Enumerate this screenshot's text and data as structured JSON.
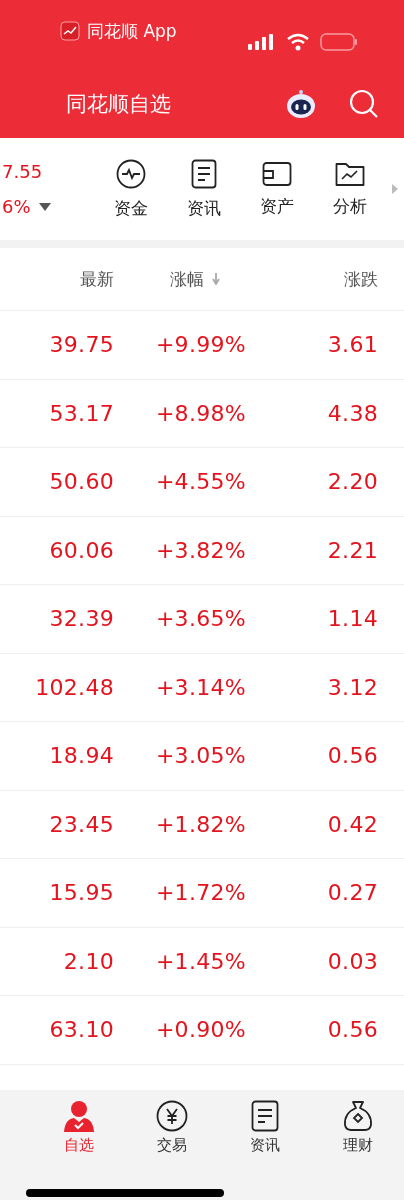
{
  "status_bar": {
    "app_name": "同花顺 App"
  },
  "header": {
    "title": "同花顺自选"
  },
  "summary": {
    "value": "7.55",
    "change": "6%"
  },
  "tools": [
    {
      "kind": "pulse",
      "label": "资金"
    },
    {
      "kind": "doc",
      "label": "资讯"
    },
    {
      "kind": "card",
      "label": "资产"
    },
    {
      "kind": "folder",
      "label": "分析"
    }
  ],
  "table": {
    "columns": [
      {
        "label": "最新",
        "sorted": false
      },
      {
        "label": "涨幅",
        "sorted": true
      },
      {
        "label": "涨跌",
        "sorted": false
      }
    ],
    "rows": [
      [
        "39.75",
        "+9.99%",
        "3.61"
      ],
      [
        "53.17",
        "+8.98%",
        "4.38"
      ],
      [
        "50.60",
        "+4.55%",
        "2.20"
      ],
      [
        "60.06",
        "+3.82%",
        "2.21"
      ],
      [
        "32.39",
        "+3.65%",
        "1.14"
      ],
      [
        "102.48",
        "+3.14%",
        "3.12"
      ],
      [
        "18.94",
        "+3.05%",
        "0.56"
      ],
      [
        "23.45",
        "+1.82%",
        "0.42"
      ],
      [
        "15.95",
        "+1.72%",
        "0.27"
      ],
      [
        "2.10",
        "+1.45%",
        "0.03"
      ],
      [
        "63.10",
        "+0.90%",
        "0.56"
      ]
    ]
  },
  "tab_bar": [
    {
      "kind": "person",
      "label": "自选",
      "selected": true
    },
    {
      "kind": "yen",
      "label": "交易",
      "selected": false
    },
    {
      "kind": "doc",
      "label": "资讯",
      "selected": false
    },
    {
      "kind": "bag",
      "label": "理财",
      "selected": false
    }
  ]
}
